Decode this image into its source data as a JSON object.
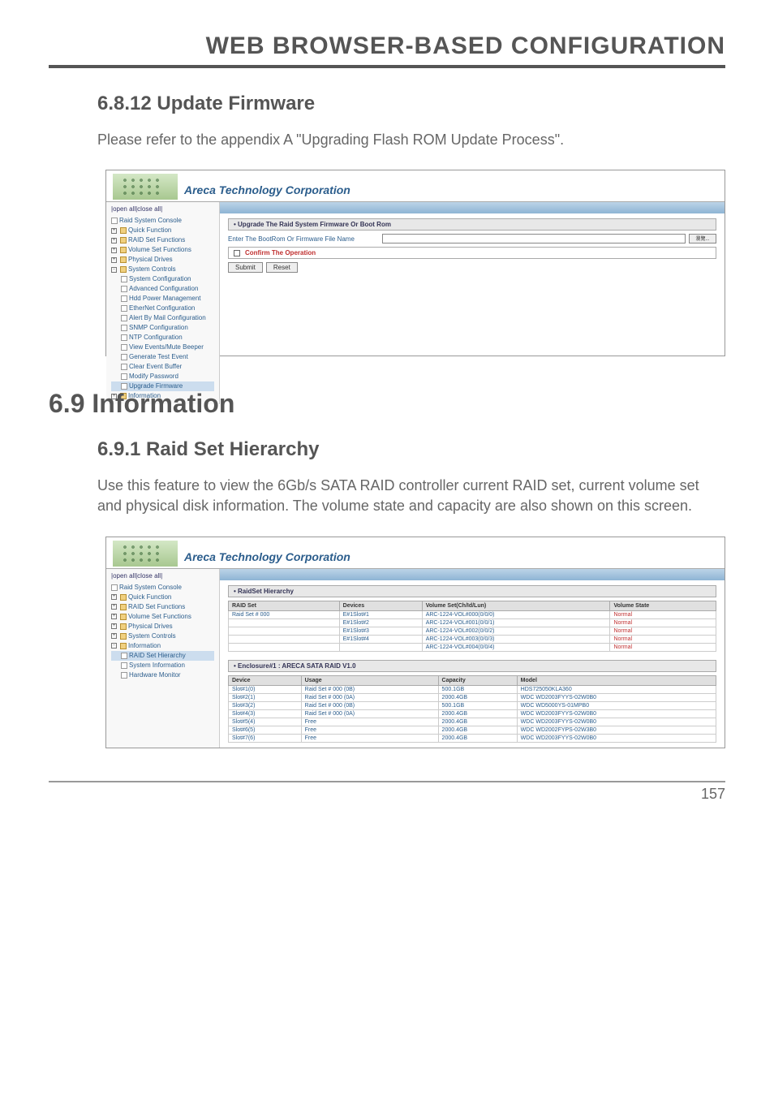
{
  "page_title": "WEB BROWSER-BASED CONFIGURATION",
  "section_6_8_12": {
    "heading": "6.8.12 Update Firmware",
    "body": "Please refer to the appendix A \"Upgrading Flash ROM Update Process\"."
  },
  "section_6_9": {
    "heading": "6.9 Information"
  },
  "section_6_9_1": {
    "heading": "6.9.1 Raid Set Hierarchy",
    "body": "Use this feature to view the 6Gb/s SATA RAID controller current RAID set, current volume set and physical disk information. The volume state and capacity are also shown on this screen."
  },
  "areca": {
    "title": "Areca Technology Corporation",
    "open_close": "|open all|close all|",
    "sidebar_root": "Raid System Console",
    "sidebar_folders": [
      "Quick Function",
      "RAID Set Functions",
      "Volume Set Functions",
      "Physical Drives",
      "System Controls",
      "Information"
    ],
    "syscontrols_children": [
      "System Configuration",
      "Advanced Configuration",
      "Hdd Power Management",
      "EtherNet Configuration",
      "Alert By Mail Configuration",
      "SNMP Configuration",
      "NTP Configuration",
      "View Events/Mute Beeper",
      "Generate Test Event",
      "Clear Event Buffer",
      "Modify Password",
      "Upgrade Firmware"
    ],
    "information_children": [
      "RAID Set Hierarchy",
      "System Information",
      "Hardware Monitor"
    ]
  },
  "upgrade_panel": {
    "header": "• Upgrade The Raid System Firmware Or Boot Rom",
    "file_label": "Enter The BootRom Or Firmware File Name",
    "browse": "瀏覽...",
    "confirm": "Confirm The Operation",
    "submit": "Submit",
    "reset": "Reset"
  },
  "hierarchy_panel": {
    "header1": "• RaidSet Hierarchy",
    "columns1": [
      "RAID Set",
      "Devices",
      "Volume Set(Ch/Id/Lun)",
      "Volume State"
    ],
    "rows1": [
      [
        "Raid Set # 000",
        "E#1Slot#1",
        "ARC-1224-VOL#000(0/0/0)",
        "Normal"
      ],
      [
        "",
        "E#1Slot#2",
        "ARC-1224-VOL#001(0/0/1)",
        "Normal"
      ],
      [
        "",
        "E#1Slot#3",
        "ARC-1224-VOL#002(0/0/2)",
        "Normal"
      ],
      [
        "",
        "E#1Slot#4",
        "ARC-1224-VOL#003(0/0/3)",
        "Normal"
      ],
      [
        "",
        "",
        "ARC-1224-VOL#004(0/0/4)",
        "Normal"
      ]
    ],
    "header2": "• Enclosure#1 : ARECA SATA RAID V1.0",
    "columns2": [
      "Device",
      "Usage",
      "Capacity",
      "Model"
    ],
    "rows2": [
      [
        "Slot#1(0)",
        "Raid Set # 000 (0B)",
        "500.1GB",
        "HDS725050KLA360"
      ],
      [
        "Slot#2(1)",
        "Raid Set # 000 (0A)",
        "2000.4GB",
        "WDC WD2003FYYS-02W0B0"
      ],
      [
        "Slot#3(2)",
        "Raid Set # 000 (0B)",
        "500.1GB",
        "WDC WD5000YS-01MPB0"
      ],
      [
        "Slot#4(3)",
        "Raid Set # 000 (0A)",
        "2000.4GB",
        "WDC WD2003FYYS-02W0B0"
      ],
      [
        "Slot#5(4)",
        "Free",
        "2000.4GB",
        "WDC WD2003FYYS-02W0B0"
      ],
      [
        "Slot#6(5)",
        "Free",
        "2000.4GB",
        "WDC WD2002FYPS-02W3B0"
      ],
      [
        "Slot#7(6)",
        "Free",
        "2000.4GB",
        "WDC WD2003FYYS-02W0B0"
      ]
    ]
  },
  "page_number": "157"
}
